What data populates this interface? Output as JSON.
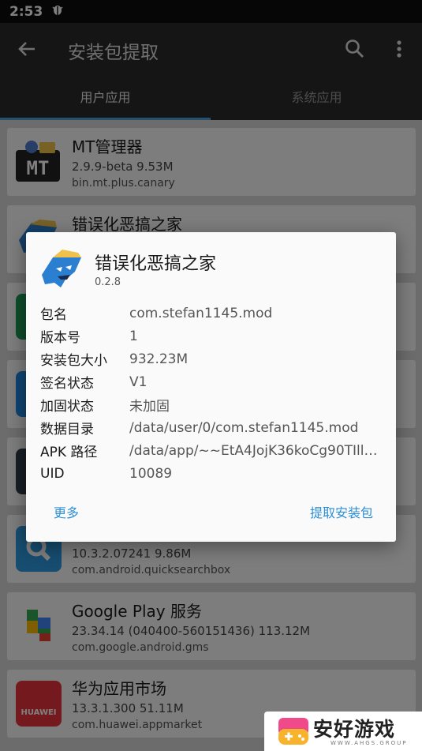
{
  "status_bar": {
    "time": "2:53",
    "notification_icon": "bug-icon"
  },
  "app_bar": {
    "title": "安装包提取",
    "back_icon": "arrow-left-icon",
    "search_icon": "search-icon",
    "more_icon": "more-vert-icon"
  },
  "tabs": [
    {
      "label": "用户应用",
      "selected": true
    },
    {
      "label": "系统应用",
      "selected": false
    }
  ],
  "apps": [
    {
      "name": "MT管理器",
      "meta": "2.9.9-beta   9.53M",
      "package": "bin.mt.plus.canary",
      "icon": "mt-manager-icon"
    },
    {
      "name": "错误化恶搞之家",
      "meta": "",
      "package": "",
      "icon": "fnf-character-icon"
    },
    {
      "name": "",
      "meta": "",
      "package": "",
      "icon": "green-app-icon"
    },
    {
      "name": "",
      "meta": "",
      "package": "",
      "icon": "blue-app-icon"
    },
    {
      "name": "",
      "meta": "",
      "package": "",
      "icon": "dark-app-icon"
    },
    {
      "name": "",
      "meta": "10.3.2.07241   9.86M",
      "package": "com.android.quicksearchbox",
      "icon": "search-app-icon"
    },
    {
      "name": "Google Play 服务",
      "meta": "23.34.14 (040400-560151436)   113.12M",
      "package": "com.google.android.gms",
      "icon": "google-play-services-icon"
    },
    {
      "name": "华为应用市场",
      "meta": "13.3.1.300   51.11M",
      "package": "com.huawei.appmarket",
      "icon": "huawei-appgallery-icon",
      "icon_text": "HUAWEI"
    }
  ],
  "dialog": {
    "app_name": "错误化恶搞之家",
    "version": "0.2.8",
    "details": [
      {
        "label": "包名",
        "value": "com.stefan1145.mod"
      },
      {
        "label": "版本号",
        "value": "1"
      },
      {
        "label": "安装包大小",
        "value": "932.23M"
      },
      {
        "label": "签名状态",
        "value": "V1"
      },
      {
        "label": "加固状态",
        "value": "未加固"
      },
      {
        "label": "数据目录",
        "value": "/data/user/0/com.stefan1145.mod"
      },
      {
        "label": "APK 路径",
        "value": "/data/app/~~EtA4JojK36koCg90TIllB…"
      },
      {
        "label": "UID",
        "value": "10089"
      }
    ],
    "more_button": "更多",
    "extract_button": "提取安装包"
  },
  "watermark": {
    "text": "安好游戏",
    "subtext": "WWW.AHGS.GROUP"
  },
  "colors": {
    "accent": "#2d8fd5",
    "tab_indicator": "#4aa3df",
    "app_bar": "#2b2b2b",
    "status_bar": "#0d0d0d"
  }
}
